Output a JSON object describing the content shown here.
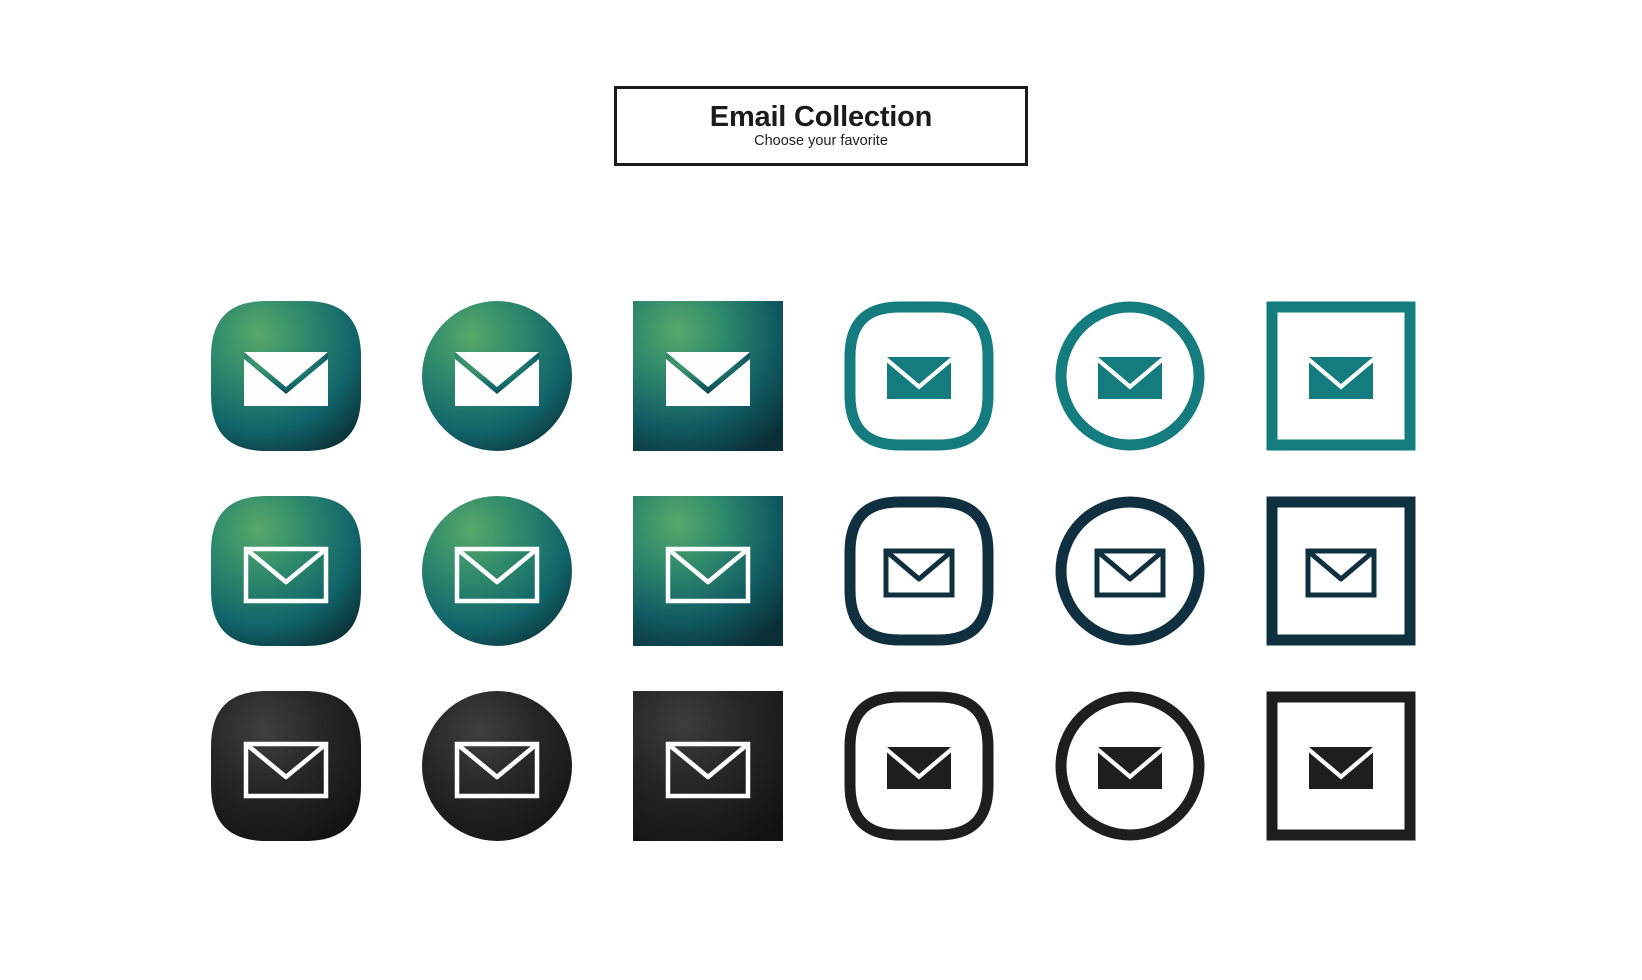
{
  "header": {
    "title": "Email Collection",
    "subtitle": "Choose your favorite",
    "border_color": "#1c1c1c"
  },
  "palette": {
    "gradient_light_green": "#4f9e64",
    "gradient_mid_teal": "#1d7a6e",
    "gradient_dark_teal": "#0d3f45",
    "gradient_deep": "#0a3036",
    "teal": "#147c7e",
    "navy": "#10303f",
    "black": "#1e1e1e",
    "black_gradient_light": "#3a3a3a",
    "black_gradient_dark": "#141414",
    "white": "#ffffff"
  },
  "grid": {
    "columns": 6,
    "rows": 3,
    "shapes": [
      "squircle",
      "circle",
      "square",
      "squircle-outline",
      "circle-outline",
      "square-outline"
    ],
    "icons": [
      {
        "row": 1,
        "col": 1,
        "name": "email-icon-gradient-squircle",
        "shape": "squircle",
        "style": "gradient-fill",
        "envelope": "solid-white",
        "color_scheme": "green-teal-gradient"
      },
      {
        "row": 1,
        "col": 2,
        "name": "email-icon-gradient-circle",
        "shape": "circle",
        "style": "gradient-fill",
        "envelope": "solid-white",
        "color_scheme": "green-teal-gradient"
      },
      {
        "row": 1,
        "col": 3,
        "name": "email-icon-gradient-square",
        "shape": "square",
        "style": "gradient-fill",
        "envelope": "solid-white",
        "color_scheme": "green-teal-gradient"
      },
      {
        "row": 1,
        "col": 4,
        "name": "email-icon-teal-squircle-outline",
        "shape": "squircle-outline",
        "style": "stroke",
        "envelope": "solid-teal",
        "color_scheme": "teal"
      },
      {
        "row": 1,
        "col": 5,
        "name": "email-icon-teal-circle-outline",
        "shape": "circle-outline",
        "style": "stroke",
        "envelope": "solid-teal",
        "color_scheme": "teal"
      },
      {
        "row": 1,
        "col": 6,
        "name": "email-icon-teal-square-outline",
        "shape": "square-outline",
        "style": "stroke",
        "envelope": "solid-teal",
        "color_scheme": "teal"
      },
      {
        "row": 2,
        "col": 1,
        "name": "email-icon-gradient-squircle-line",
        "shape": "squircle",
        "style": "gradient-fill",
        "envelope": "outline-white",
        "color_scheme": "green-teal-gradient"
      },
      {
        "row": 2,
        "col": 2,
        "name": "email-icon-gradient-circle-line",
        "shape": "circle",
        "style": "gradient-fill",
        "envelope": "outline-white",
        "color_scheme": "green-teal-gradient"
      },
      {
        "row": 2,
        "col": 3,
        "name": "email-icon-gradient-square-line",
        "shape": "square",
        "style": "gradient-fill",
        "envelope": "outline-white",
        "color_scheme": "green-teal-gradient"
      },
      {
        "row": 2,
        "col": 4,
        "name": "email-icon-navy-squircle-outline",
        "shape": "squircle-outline",
        "style": "stroke",
        "envelope": "outline-navy",
        "color_scheme": "navy"
      },
      {
        "row": 2,
        "col": 5,
        "name": "email-icon-navy-circle-outline",
        "shape": "circle-outline",
        "style": "stroke",
        "envelope": "outline-navy",
        "color_scheme": "navy"
      },
      {
        "row": 2,
        "col": 6,
        "name": "email-icon-navy-square-outline",
        "shape": "square-outline",
        "style": "stroke",
        "envelope": "outline-navy",
        "color_scheme": "navy"
      },
      {
        "row": 3,
        "col": 1,
        "name": "email-icon-black-squircle",
        "shape": "squircle",
        "style": "gradient-fill",
        "envelope": "outline-white",
        "color_scheme": "black"
      },
      {
        "row": 3,
        "col": 2,
        "name": "email-icon-black-circle",
        "shape": "circle",
        "style": "gradient-fill",
        "envelope": "outline-white",
        "color_scheme": "black"
      },
      {
        "row": 3,
        "col": 3,
        "name": "email-icon-black-square",
        "shape": "square",
        "style": "gradient-fill",
        "envelope": "outline-white",
        "color_scheme": "black"
      },
      {
        "row": 3,
        "col": 4,
        "name": "email-icon-black-squircle-outline",
        "shape": "squircle-outline",
        "style": "stroke",
        "envelope": "solid-black",
        "color_scheme": "black"
      },
      {
        "row": 3,
        "col": 5,
        "name": "email-icon-black-circle-outline",
        "shape": "circle-outline",
        "style": "stroke",
        "envelope": "solid-black",
        "color_scheme": "black"
      },
      {
        "row": 3,
        "col": 6,
        "name": "email-icon-black-square-outline",
        "shape": "square-outline",
        "style": "stroke",
        "envelope": "solid-black",
        "color_scheme": "black"
      }
    ]
  }
}
